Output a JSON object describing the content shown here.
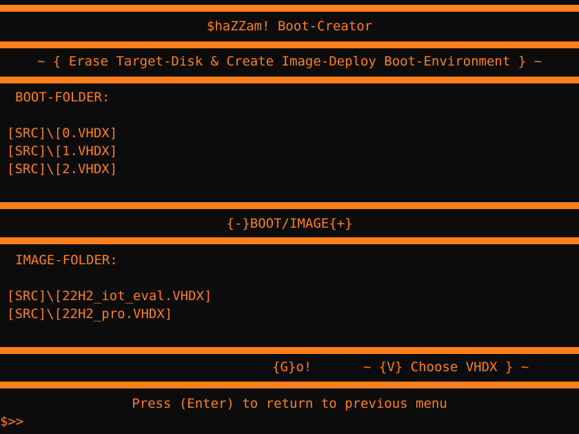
{
  "header": {
    "title": "$haZZam! Boot-Creator",
    "subtitle": "~ { Erase Target-Disk & Create Image-Deploy Boot-Environment } ~"
  },
  "boot_section": {
    "label": "BOOT-FOLDER:",
    "items": [
      "[SRC]\\[0.VHDX]",
      "[SRC]\\[1.VHDX]",
      "[SRC]\\[2.VHDX]"
    ]
  },
  "toggle": {
    "label": "{-}BOOT/IMAGE{+}"
  },
  "image_section": {
    "label": "IMAGE-FOLDER:",
    "items": [
      "[SRC]\\[22H2_iot_eval.VHDX]",
      "[SRC]\\[22H2_pro.VHDX]"
    ]
  },
  "actions": {
    "go_label": "{G}o!",
    "choose_label": "~ {V} Choose VHDX } ~"
  },
  "footer": {
    "message": "Press (Enter) to return to previous menu",
    "prompt": "$>>"
  },
  "colors": {
    "accent": "#ff7f1a",
    "background": "#0c0c0c"
  }
}
